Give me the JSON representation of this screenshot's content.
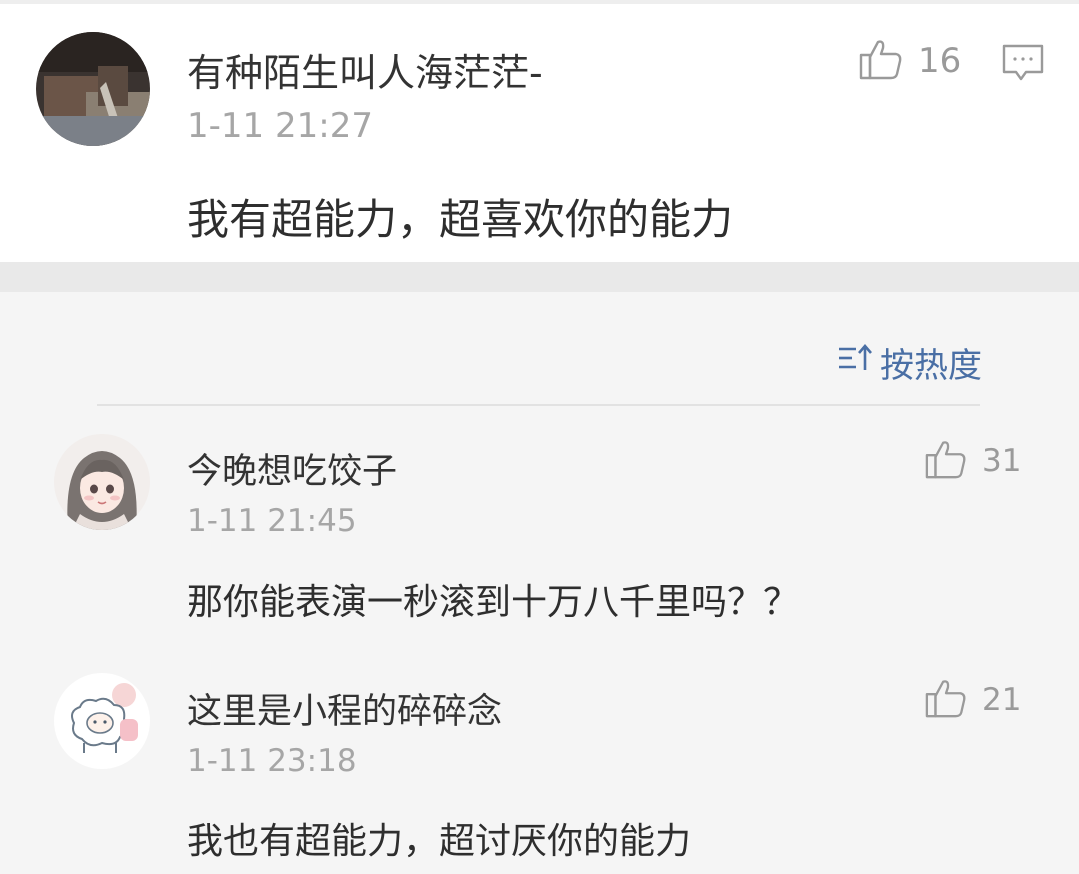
{
  "main_comment": {
    "username": "有种陌生叫人海茫茫-",
    "timestamp": "1-11 21:27",
    "text": "我有超能力，超喜欢你的能力",
    "likes": "16",
    "like_icon": "thumbs-up-icon",
    "reply_icon": "comment-icon"
  },
  "sort": {
    "label": "按热度",
    "icon": "sort-icon"
  },
  "replies": [
    {
      "username": "今晚想吃饺子",
      "timestamp": "1-11 21:45",
      "text": "那你能表演一秒滚到十万八千里吗？？",
      "likes": "31"
    },
    {
      "username": "这里是小程的碎碎念",
      "timestamp": "1-11 23:18",
      "text": "我也有超能力，超讨厌你的能力",
      "likes": "21"
    }
  ],
  "colors": {
    "text_primary": "#333333",
    "text_secondary": "#a6a6a6",
    "link_blue": "#4a6fa5",
    "replies_bg": "#f5f5f5"
  }
}
